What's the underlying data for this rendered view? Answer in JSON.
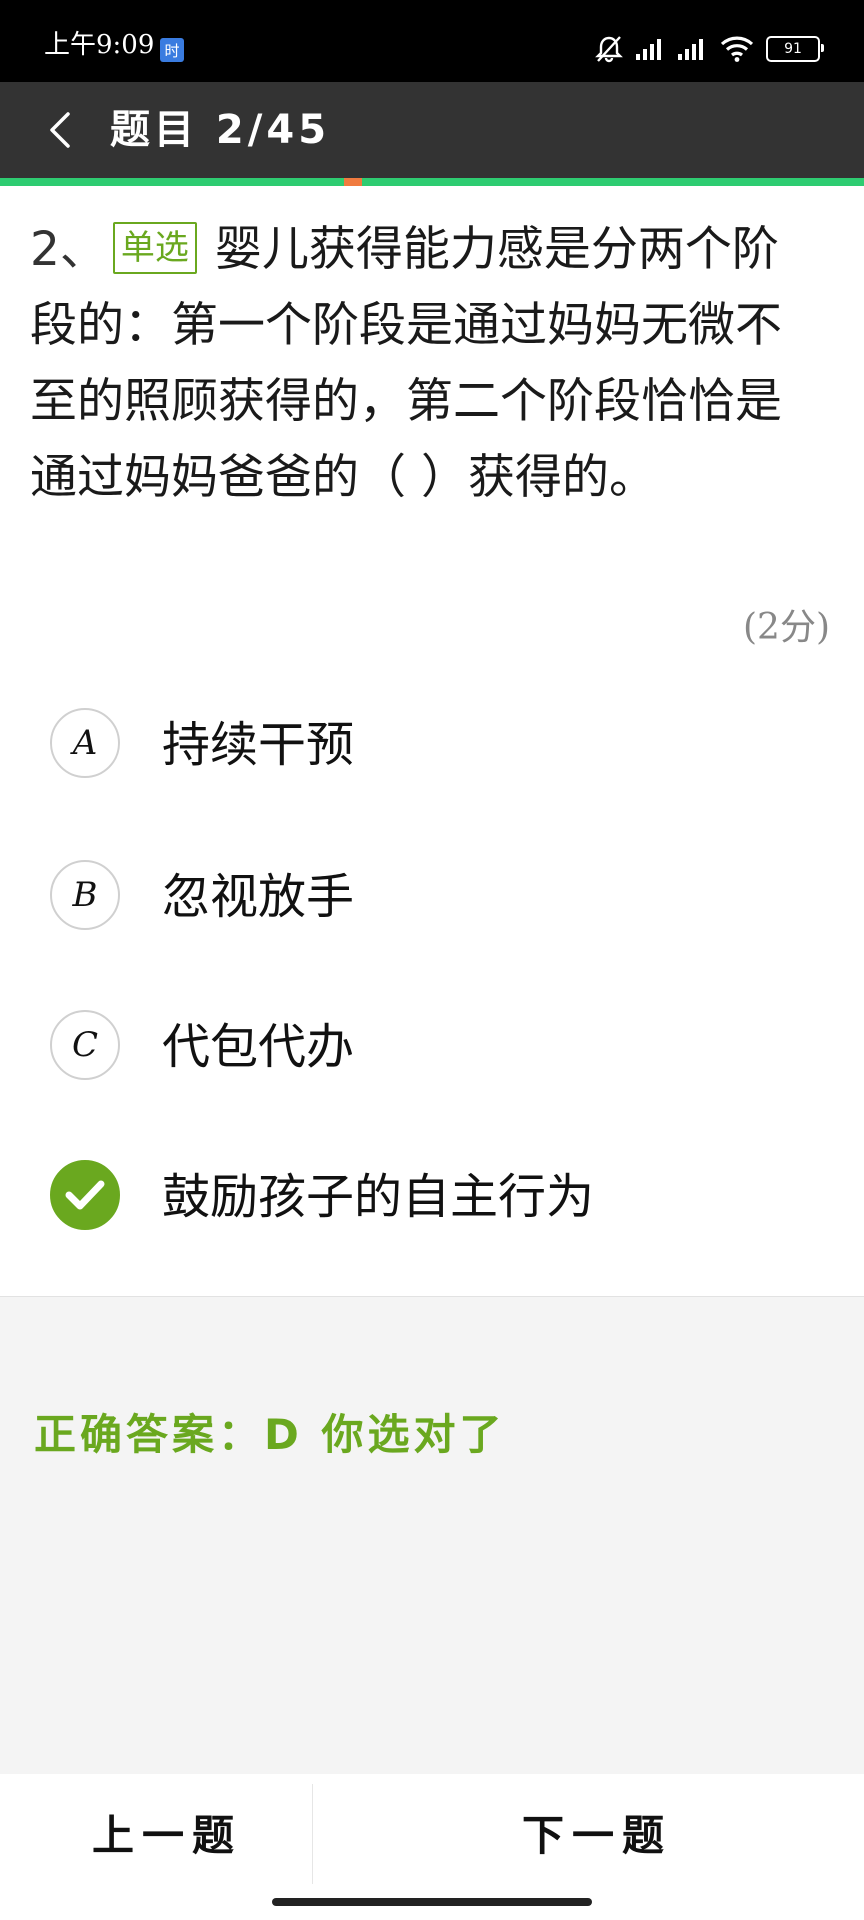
{
  "status_bar": {
    "time": "上午9:09",
    "badge": "时",
    "battery": "91"
  },
  "header": {
    "title": "题目 2/45"
  },
  "question": {
    "number": "2、",
    "type": "单选",
    "text": "婴儿获得能力感是分两个阶段的：第一个阶段是通过妈妈无微不至的照顾获得的，第二个阶段恰恰是通过妈妈爸爸的（ ）获得的。",
    "score": "(2分)"
  },
  "options": [
    {
      "letter": "A",
      "text": "持续干预",
      "checked": false
    },
    {
      "letter": "B",
      "text": "忽视放手",
      "checked": false
    },
    {
      "letter": "C",
      "text": "代包代办",
      "checked": false
    },
    {
      "letter": "D",
      "text": "鼓励孩子的自主行为",
      "checked": true
    }
  ],
  "result": {
    "text": "正确答案：D 你选对了"
  },
  "nav": {
    "prev_label": "上一题",
    "next_label": "下一题"
  },
  "colors": {
    "accent_green": "#6aa81f",
    "progress_green": "#2ecc71",
    "progress_marker": "#f07b3f",
    "header_bg": "#333333"
  },
  "icons": {
    "back": "chevron-left-icon",
    "mute": "bell-off-icon",
    "signal": "signal-icon",
    "wifi": "wifi-icon",
    "check": "check-icon"
  }
}
